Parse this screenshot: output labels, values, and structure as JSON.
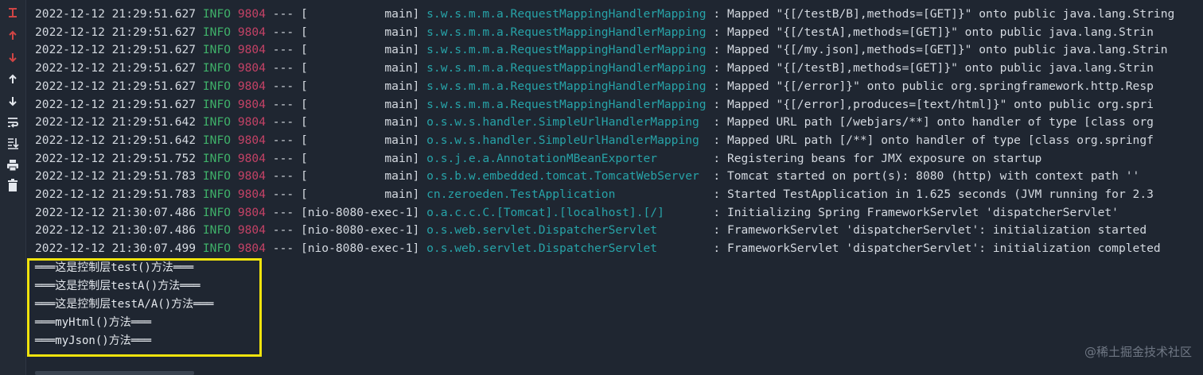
{
  "toolbar": {
    "icons": [
      "rerun-icon",
      "scroll-up-icon",
      "scroll-down-icon",
      "up-arrow-icon",
      "down-arrow-icon",
      "soft-wrap-icon",
      "scroll-to-end-icon",
      "print-icon",
      "trash-icon"
    ]
  },
  "log": {
    "columns": [
      "timestamp",
      "level",
      "pid",
      "separator",
      "thread",
      "logger",
      "message"
    ],
    "rows": [
      {
        "ts": "2022-12-12 21:29:51.627",
        "lvl": "INFO",
        "pid": "9804",
        "sep": "---",
        "thread": "[           main]",
        "logger": "s.w.s.m.m.a.RequestMappingHandlerMapping",
        "msg": ": Mapped \"{[/testB/B],methods=[GET]}\" onto public java.lang.String"
      },
      {
        "ts": "2022-12-12 21:29:51.627",
        "lvl": "INFO",
        "pid": "9804",
        "sep": "---",
        "thread": "[           main]",
        "logger": "s.w.s.m.m.a.RequestMappingHandlerMapping",
        "msg": ": Mapped \"{[/testA],methods=[GET]}\" onto public java.lang.Strin"
      },
      {
        "ts": "2022-12-12 21:29:51.627",
        "lvl": "INFO",
        "pid": "9804",
        "sep": "---",
        "thread": "[           main]",
        "logger": "s.w.s.m.m.a.RequestMappingHandlerMapping",
        "msg": ": Mapped \"{[/my.json],methods=[GET]}\" onto public java.lang.Strin"
      },
      {
        "ts": "2022-12-12 21:29:51.627",
        "lvl": "INFO",
        "pid": "9804",
        "sep": "---",
        "thread": "[           main]",
        "logger": "s.w.s.m.m.a.RequestMappingHandlerMapping",
        "msg": ": Mapped \"{[/testB],methods=[GET]}\" onto public java.lang.Strin"
      },
      {
        "ts": "2022-12-12 21:29:51.627",
        "lvl": "INFO",
        "pid": "9804",
        "sep": "---",
        "thread": "[           main]",
        "logger": "s.w.s.m.m.a.RequestMappingHandlerMapping",
        "msg": ": Mapped \"{[/error]}\" onto public org.springframework.http.Resp"
      },
      {
        "ts": "2022-12-12 21:29:51.627",
        "lvl": "INFO",
        "pid": "9804",
        "sep": "---",
        "thread": "[           main]",
        "logger": "s.w.s.m.m.a.RequestMappingHandlerMapping",
        "msg": ": Mapped \"{[/error],produces=[text/html]}\" onto public org.spri"
      },
      {
        "ts": "2022-12-12 21:29:51.642",
        "lvl": "INFO",
        "pid": "9804",
        "sep": "---",
        "thread": "[           main]",
        "logger": "o.s.w.s.handler.SimpleUrlHandlerMapping ",
        "msg": ": Mapped URL path [/webjars/**] onto handler of type [class org"
      },
      {
        "ts": "2022-12-12 21:29:51.642",
        "lvl": "INFO",
        "pid": "9804",
        "sep": "---",
        "thread": "[           main]",
        "logger": "o.s.w.s.handler.SimpleUrlHandlerMapping ",
        "msg": ": Mapped URL path [/**] onto handler of type [class org.springf"
      },
      {
        "ts": "2022-12-12 21:29:51.752",
        "lvl": "INFO",
        "pid": "9804",
        "sep": "---",
        "thread": "[           main]",
        "logger": "o.s.j.e.a.AnnotationMBeanExporter       ",
        "msg": ": Registering beans for JMX exposure on startup"
      },
      {
        "ts": "2022-12-12 21:29:51.783",
        "lvl": "INFO",
        "pid": "9804",
        "sep": "---",
        "thread": "[           main]",
        "logger": "o.s.b.w.embedded.tomcat.TomcatWebServer ",
        "msg": ": Tomcat started on port(s): 8080 (http) with context path ''"
      },
      {
        "ts": "2022-12-12 21:29:51.783",
        "lvl": "INFO",
        "pid": "9804",
        "sep": "---",
        "thread": "[           main]",
        "logger": "cn.zeroeden.TestApplication             ",
        "msg": ": Started TestApplication in 1.625 seconds (JVM running for 2.3"
      },
      {
        "ts": "2022-12-12 21:30:07.486",
        "lvl": "INFO",
        "pid": "9804",
        "sep": "---",
        "thread": "[nio-8080-exec-1]",
        "logger": "o.a.c.c.C.[Tomcat].[localhost].[/]      ",
        "msg": ": Initializing Spring FrameworkServlet 'dispatcherServlet'"
      },
      {
        "ts": "2022-12-12 21:30:07.486",
        "lvl": "INFO",
        "pid": "9804",
        "sep": "---",
        "thread": "[nio-8080-exec-1]",
        "logger": "o.s.web.servlet.DispatcherServlet       ",
        "msg": ": FrameworkServlet 'dispatcherServlet': initialization started"
      },
      {
        "ts": "2022-12-12 21:30:07.499",
        "lvl": "INFO",
        "pid": "9804",
        "sep": "---",
        "thread": "[nio-8080-exec-1]",
        "logger": "o.s.web.servlet.DispatcherServlet       ",
        "msg": ": FrameworkServlet 'dispatcherServlet': initialization completed"
      }
    ]
  },
  "output": [
    "═══这是控制层test()方法═══",
    "═══这是控制层testA()方法═══",
    "═══这是控制层testA/A()方法═══",
    "═══myHtml()方法═══",
    "═══myJson()方法═══"
  ],
  "watermark": "@稀土掘金技术社区",
  "colors": {
    "background": "#1f2631",
    "level": "#3fb069",
    "pid": "#c44266",
    "logger": "#27a3a8",
    "highlight": "#f0e30d"
  }
}
